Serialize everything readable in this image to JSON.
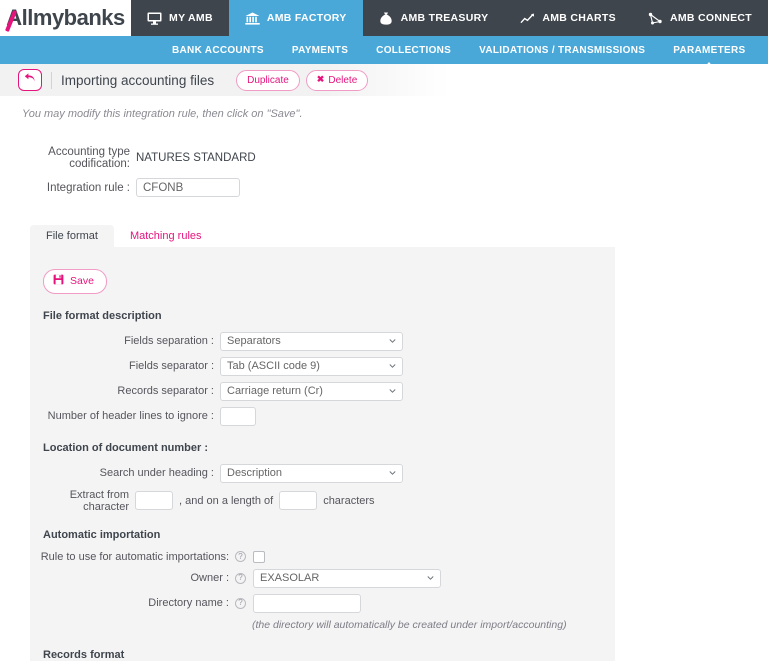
{
  "brand": {
    "logo_text": "Allmybanks",
    "accent_pink": "#e5147d",
    "accent_blue": "#4aa8d8",
    "dark": "#3f454c"
  },
  "topnav": {
    "items": [
      {
        "label": "MY AMB",
        "icon": "monitor-icon",
        "active": false
      },
      {
        "label": "AMB FACTORY",
        "icon": "bank-building-icon",
        "active": true
      },
      {
        "label": "AMB TREASURY",
        "icon": "money-bag-icon",
        "active": false
      },
      {
        "label": "AMB CHARTS",
        "icon": "line-chart-icon",
        "active": false
      },
      {
        "label": "AMB CONNECT",
        "icon": "network-share-icon",
        "active": false
      }
    ]
  },
  "subnav": {
    "items": [
      {
        "label": "BANK ACCOUNTS",
        "active": false
      },
      {
        "label": "PAYMENTS",
        "active": false
      },
      {
        "label": "COLLECTIONS",
        "active": false
      },
      {
        "label": "VALIDATIONS / TRANSMISSIONS",
        "active": false
      },
      {
        "label": "PARAMETERS",
        "active": true
      }
    ]
  },
  "titlebar": {
    "back_icon": "back-arrow-icon",
    "title": "Importing accounting files",
    "duplicate_label": "Duplicate",
    "delete_label": "Delete",
    "delete_icon": "cross-icon"
  },
  "hint": "You may modify this integration rule, then click on \"Save\".",
  "topform": {
    "accounting_type_label": "Accounting type codification:",
    "accounting_type_value": "NATURES STANDARD",
    "integration_rule_label": "Integration rule :",
    "integration_rule_value": "CFONB"
  },
  "tabs": [
    {
      "label": "File format",
      "active": true
    },
    {
      "label": "Matching rules",
      "active": false
    }
  ],
  "panel": {
    "save_label": "Save",
    "save_icon": "floppy-disk-icon",
    "file_format_section": {
      "title": "File format description",
      "fields_separation_label": "Fields separation :",
      "fields_separation_value": "Separators",
      "fields_separator_label": "Fields separator :",
      "fields_separator_value": "Tab (ASCII code 9)",
      "records_separator_label": "Records separator :",
      "records_separator_value": "Carriage return (Cr)",
      "header_lines_label": "Number of header lines to ignore :",
      "header_lines_value": ""
    },
    "document_number_section": {
      "title": "Location of document number :",
      "search_heading_label": "Search under heading :",
      "search_heading_value": "Description",
      "extract_from_label": "Extract from character",
      "extract_from_value": "",
      "length_mid_label": ", and on a length of",
      "length_value": "",
      "characters_label": "characters"
    },
    "automatic_importation_section": {
      "title": "Automatic importation",
      "rule_label": "Rule to use for automatic importations:",
      "rule_checked": false,
      "owner_label": "Owner :",
      "owner_value": "EXASOLAR",
      "directory_label": "Directory name :",
      "directory_value": "",
      "directory_note": "(the directory will automatically be created under import/accounting)"
    },
    "records_format_title": "Records format"
  }
}
